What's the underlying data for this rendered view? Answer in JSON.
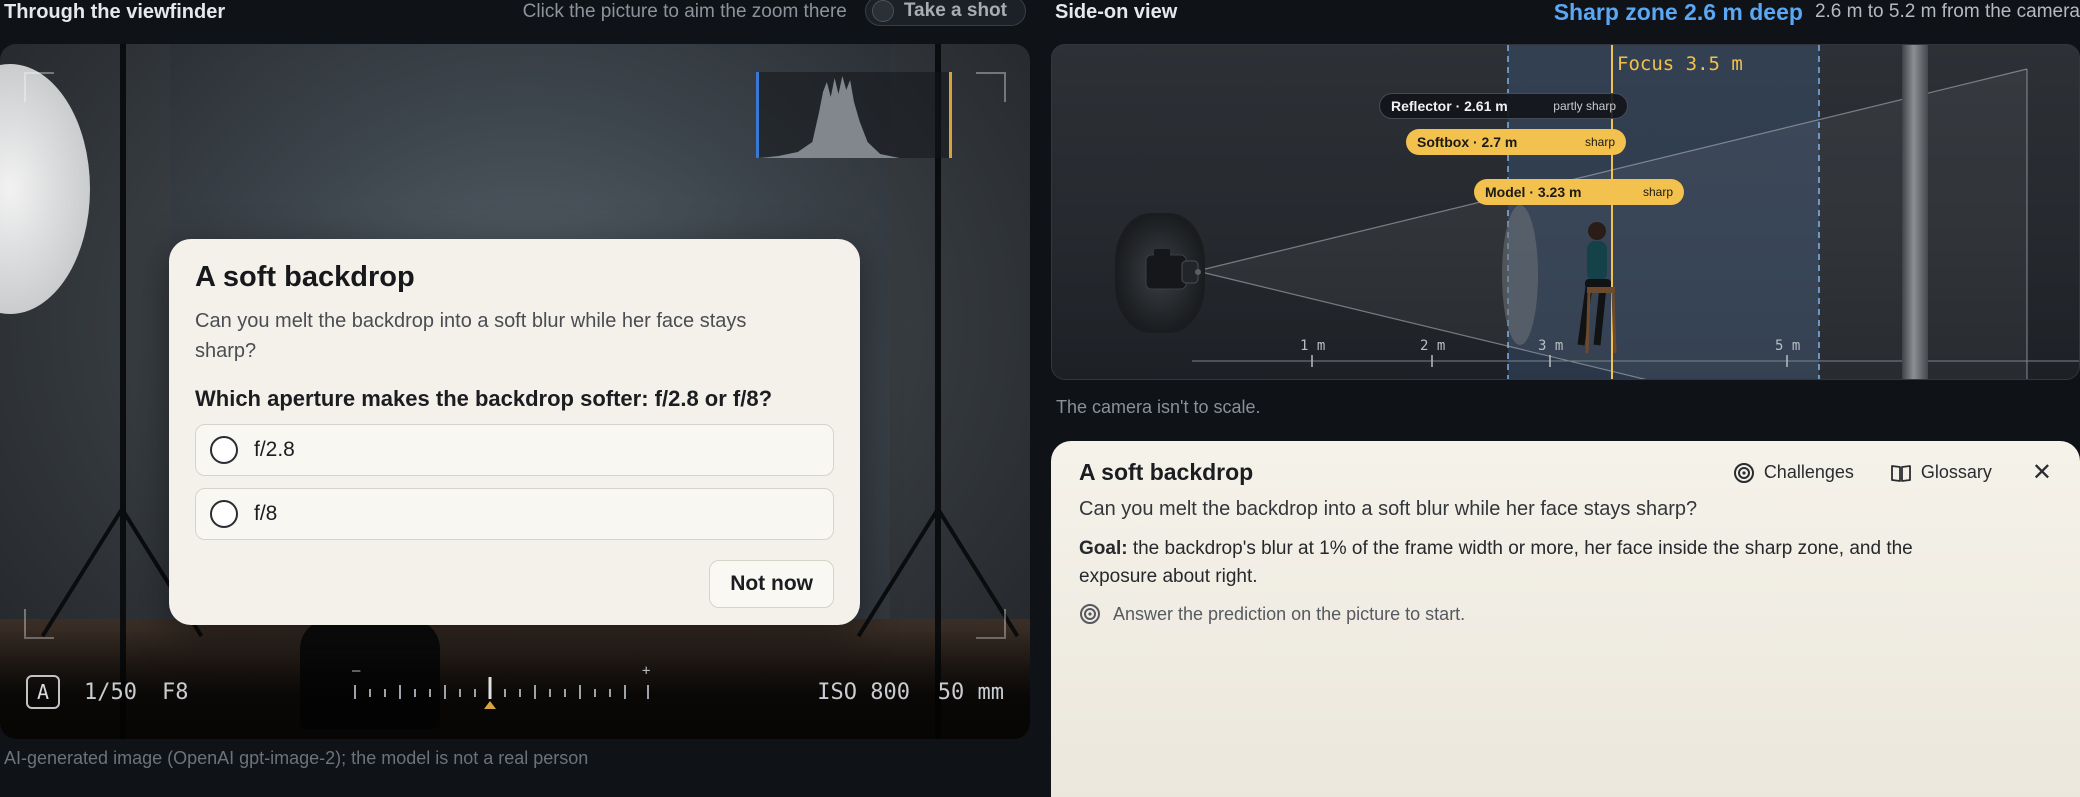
{
  "viewfinder": {
    "title": "Through the viewfinder",
    "hint": "Click the picture to aim the zoom there",
    "shot_label": "Take a shot",
    "mode": "A",
    "shutter": "1/50",
    "fstop": "F8",
    "iso": "ISO 800",
    "focal": "50 mm",
    "meter_minus": "–",
    "meter_plus": "+",
    "credit": "AI-generated image (OpenAI gpt-image-2); the model is not a real person"
  },
  "quiz": {
    "title": "A soft backdrop",
    "description": "Can you melt the backdrop into a soft blur while her face stays sharp?",
    "question": "Which aperture makes the backdrop softer: f/2.8 or f/8?",
    "options": [
      "f/2.8",
      "f/8"
    ],
    "dismiss_label": "Not now"
  },
  "sideview": {
    "title": "Side-on view",
    "zone_label": "Sharp zone 2.6 m deep",
    "zone_range": "2.6 m to 5.2 m from the camera",
    "focus_label": "Focus 3.5 m",
    "objects": [
      {
        "name": "Reflector · 2.61 m",
        "status": "partly sharp"
      },
      {
        "name": "Softbox · 2.7 m",
        "status": "sharp"
      },
      {
        "name": "Model · 3.23 m",
        "status": "sharp"
      }
    ],
    "ticks": [
      "1 m",
      "2 m",
      "3 m",
      "5 m"
    ],
    "note": "The camera isn't to scale."
  },
  "panel": {
    "title": "A soft backdrop",
    "challenges_label": "Challenges",
    "glossary_label": "Glossary",
    "close_label": "✕",
    "description": "Can you melt the backdrop into a soft blur while her face stays sharp?",
    "goal_prefix": "Goal:",
    "goal_text": " the backdrop's blur at 1% of the frame width or more, her face inside the sharp zone, and the exposure about right.",
    "hint": "Answer the prediction on the picture to start."
  },
  "colors": {
    "accent_blue": "#5aa7f5",
    "focus_gold": "#f2c14e",
    "page_bg": "#0f1217"
  }
}
